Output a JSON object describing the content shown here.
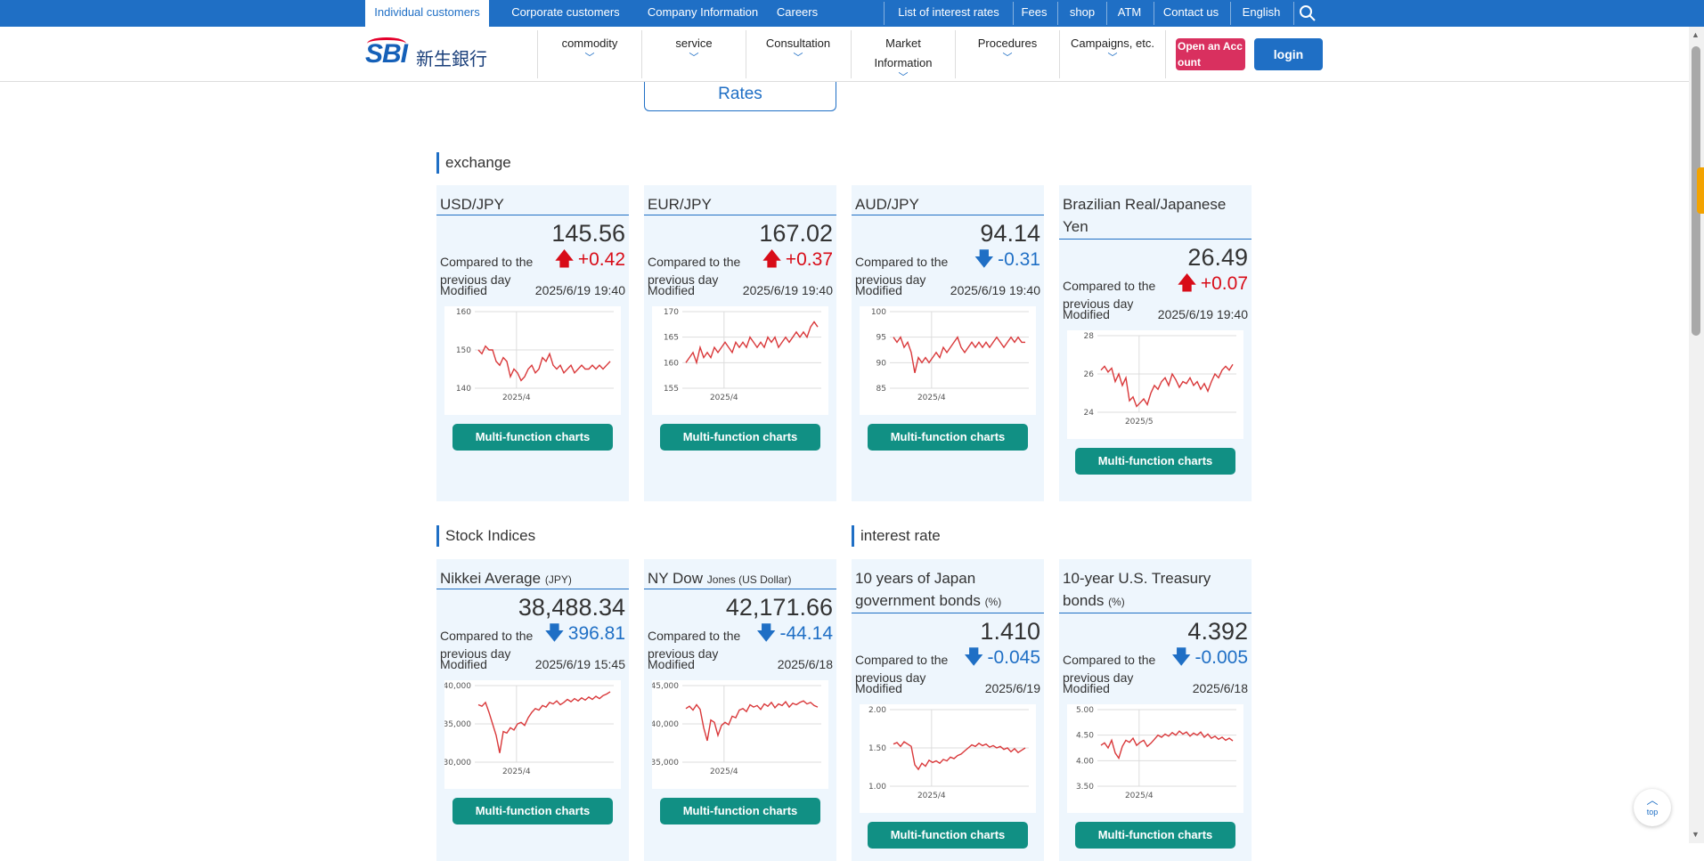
{
  "topnav": {
    "left": [
      "Individual customers",
      "Corporate customers",
      "Company Information",
      "Careers"
    ],
    "right": [
      "List of interest rates",
      "Fees",
      "shop",
      "ATM",
      "Contact us",
      "English"
    ]
  },
  "logo": {
    "sbi": "SBI",
    "kanji": "新生銀行"
  },
  "mainnav": [
    "commodity",
    "service",
    "Consultation",
    "Market Information",
    "Procedures",
    "Campaigns, etc."
  ],
  "buttons": {
    "open_account": "Open an Account",
    "login": "login"
  },
  "rates_tab": "Rates",
  "sections": {
    "exchange": "exchange",
    "stock": "Stock Indices",
    "interest": "interest rate"
  },
  "labels": {
    "compared": "Compared to the previous day",
    "modified": "Modified",
    "mfc": "Multi-function charts",
    "top": "top"
  },
  "cards": [
    {
      "title": "USD/JPY",
      "sub": "",
      "value": "145.56",
      "change": "+0.42",
      "dir": "up",
      "modified": "2025/6/19 19:40",
      "chart": {
        "ylabels": [
          "160",
          "150",
          "140"
        ],
        "ylim": [
          140,
          160
        ],
        "xlabel": "2025/4",
        "y": [
          150,
          149,
          151,
          150,
          150,
          147,
          146,
          148,
          147,
          143,
          145,
          144,
          142,
          143,
          145,
          146,
          144,
          145,
          148,
          147,
          149,
          146,
          145,
          146,
          144,
          145,
          146,
          144,
          145,
          146,
          145,
          145,
          146,
          145,
          146,
          145,
          146,
          147
        ]
      }
    },
    {
      "title": "EUR/JPY",
      "sub": "",
      "value": "167.02",
      "change": "+0.37",
      "dir": "up",
      "modified": "2025/6/19 19:40",
      "chart": {
        "ylabels": [
          "170",
          "165",
          "160",
          "155"
        ],
        "ylim": [
          155,
          170
        ],
        "xlabel": "2025/4",
        "y": [
          160,
          161,
          162,
          160,
          163,
          161,
          162,
          161,
          163,
          162,
          163,
          164,
          163,
          162,
          164,
          163,
          164,
          163,
          165,
          164,
          163,
          164,
          163,
          165,
          164,
          165,
          163,
          164,
          165,
          164,
          165,
          166,
          165,
          166,
          165,
          167,
          168,
          167
        ]
      }
    },
    {
      "title": "AUD/JPY",
      "sub": "",
      "value": "94.14",
      "change": "-0.31",
      "dir": "down",
      "modified": "2025/6/19 19:40",
      "chart": {
        "ylabels": [
          "100",
          "95",
          "90",
          "85"
        ],
        "ylim": [
          85,
          100
        ],
        "xlabel": "2025/4",
        "y": [
          95,
          94,
          95,
          93,
          94,
          92,
          88,
          91,
          90,
          91,
          90,
          91,
          92,
          91,
          93,
          92,
          93,
          94,
          95,
          93,
          92,
          93,
          94,
          93,
          94,
          93,
          94,
          93,
          94,
          95,
          94,
          93,
          94,
          95,
          94,
          95,
          94,
          94
        ]
      }
    },
    {
      "title": "Brazilian Real/Japanese Yen",
      "sub": "",
      "value": "26.49",
      "change": "+0.07",
      "dir": "up",
      "modified": "2025/6/19 19:40",
      "chart": {
        "ylabels": [
          "28",
          "26",
          "24"
        ],
        "ylim": [
          24,
          28
        ],
        "xlabel": "2025/5",
        "y": [
          26.2,
          26.4,
          26.1,
          26.3,
          25.6,
          26.0,
          25.4,
          25.8,
          24.6,
          24.8,
          24.3,
          24.5,
          24.7,
          24.4,
          25.0,
          25.4,
          25.2,
          25.6,
          25.8,
          25.4,
          26.0,
          25.7,
          25.3,
          25.6,
          25.5,
          25.8,
          25.4,
          25.6,
          25.2,
          25.5,
          25.1,
          25.6,
          26.0,
          25.8,
          26.2,
          26.4,
          26.2,
          26.5
        ]
      }
    },
    {
      "title": "Nikkei Average",
      "sub": "(JPY)",
      "value": "38,488.34",
      "change": "396.81",
      "dir": "down",
      "modified": "2025/6/19 15:45",
      "chart": {
        "ylabels": [
          "40,000",
          "35,000",
          "30,000"
        ],
        "ylim": [
          30000,
          40000
        ],
        "xlabel": "2025/4",
        "y": [
          37500,
          37300,
          37800,
          36500,
          35000,
          33500,
          31200,
          34000,
          33800,
          34500,
          34200,
          35000,
          35200,
          34800,
          35800,
          36500,
          37000,
          36800,
          37400,
          37200,
          37800,
          37600,
          38000,
          37500,
          37800,
          38200,
          37900,
          38300,
          38000,
          38400,
          38100,
          38500,
          38200,
          38600,
          38300,
          38700,
          38900,
          39200
        ]
      }
    },
    {
      "title": "NY Dow",
      "sub": "Jones (US Dollar)",
      "value": "42,171.66",
      "change": "-44.14",
      "dir": "down",
      "modified": "2025/6/18",
      "chart": {
        "ylabels": [
          "45,000",
          "40,000",
          "35,000"
        ],
        "ylim": [
          35000,
          45000
        ],
        "xlabel": "2025/4",
        "y": [
          42000,
          42300,
          41800,
          42500,
          41900,
          39500,
          37800,
          40500,
          40200,
          38500,
          39800,
          40200,
          39900,
          41000,
          40800,
          41800,
          42000,
          41600,
          42500,
          42200,
          42400,
          41900,
          42600,
          42300,
          42800,
          42100,
          42600,
          42400,
          42900,
          42200,
          42700,
          42500,
          42800,
          43000,
          42600,
          42800,
          42400,
          42200
        ]
      }
    },
    {
      "title": "10 years of Japan government bonds",
      "sub": "(%)",
      "value": "1.410",
      "change": "-0.045",
      "dir": "down",
      "modified": "2025/6/19",
      "chart": {
        "ylabels": [
          "2.00",
          "1.50",
          "1.00"
        ],
        "ylim": [
          1.0,
          2.0
        ],
        "xlabel": "2025/4",
        "y": [
          1.55,
          1.57,
          1.52,
          1.58,
          1.55,
          1.52,
          1.28,
          1.22,
          1.3,
          1.26,
          1.34,
          1.31,
          1.33,
          1.3,
          1.35,
          1.33,
          1.38,
          1.36,
          1.4,
          1.42,
          1.46,
          1.5,
          1.54,
          1.52,
          1.56,
          1.53,
          1.55,
          1.51,
          1.53,
          1.5,
          1.52,
          1.48,
          1.5,
          1.45,
          1.49,
          1.44,
          1.47,
          1.5
        ]
      }
    },
    {
      "title": "10-year U.S. Treasury bonds",
      "sub": "(%)",
      "value": "4.392",
      "change": "-0.005",
      "dir": "down",
      "modified": "2025/6/18",
      "chart": {
        "ylabels": [
          "5.00",
          "4.50",
          "4.00",
          "3.50"
        ],
        "ylim": [
          3.5,
          5.0
        ],
        "xlabel": "2025/4",
        "y": [
          4.3,
          4.35,
          4.25,
          4.4,
          4.15,
          4.05,
          4.28,
          4.4,
          4.36,
          4.44,
          4.3,
          4.36,
          4.4,
          4.28,
          4.34,
          4.42,
          4.5,
          4.46,
          4.52,
          4.48,
          4.55,
          4.5,
          4.58,
          4.52,
          4.56,
          4.48,
          4.54,
          4.5,
          4.56,
          4.46,
          4.52,
          4.44,
          4.48,
          4.42,
          4.46,
          4.4,
          4.44,
          4.39
        ]
      }
    }
  ]
}
